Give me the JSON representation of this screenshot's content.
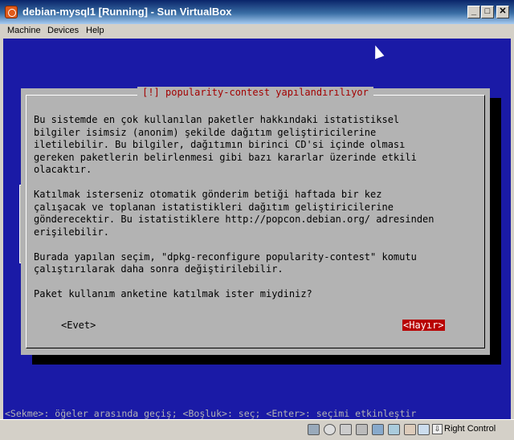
{
  "window": {
    "title": "debian-mysql1 [Running] - Sun VirtualBox"
  },
  "menu": [
    "Machine",
    "Devices",
    "Help"
  ],
  "dialog": {
    "title": "[!] popularity-contest yapılandırılıyor",
    "lines": [
      "Bu sistemde en çok kullanılan paketler hakkındaki istatistiksel",
      "bilgiler isimsiz (anonim) şekilde dağıtım geliştiricilerine",
      "iletilebilir. Bu bilgiler, dağıtımın birinci CD'si içinde olması",
      "gereken paketlerin belirlenmesi gibi bazı kararlar üzerinde etkili",
      "olacaktır.",
      "",
      "Katılmak isterseniz otomatik gönderim betiği haftada bir kez",
      "çalışacak ve toplanan istatistikleri dağıtım geliştiricilerine",
      "gönderecektir. Bu istatistiklere http://popcon.debian.org/ adresinden",
      "erişilebilir.",
      "",
      "Burada yapılan seçim, \"dpkg-reconfigure popularity-contest\" komutu",
      "çalıştırılarak daha sonra değiştirilebilir.",
      "",
      "Paket kullanım anketine katılmak ister miydiniz?"
    ],
    "yes_label": "<Evet>",
    "no_label": "<Hayır>"
  },
  "status_line": "<Sekme>: öğeler arasında geçiş; <Boşluk>: seç; <Enter>: seçimi etkinleştir",
  "statusbar": {
    "host_key": "Right Control"
  },
  "colors": {
    "vm_background": "#1a1aa6",
    "dialog_bg": "#b3b3b3",
    "dialog_title": "#a30000",
    "selected_button": "#b80000"
  }
}
